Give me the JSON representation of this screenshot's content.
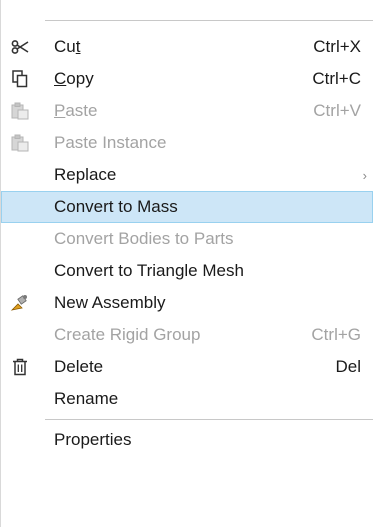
{
  "menu": {
    "cut": {
      "label": "Cut",
      "shortcut": "Ctrl+X",
      "icon": "scissors-icon"
    },
    "copy": {
      "label": "Copy",
      "shortcut": "Ctrl+C",
      "icon": "copy-icon"
    },
    "paste": {
      "label": "Paste",
      "shortcut": "Ctrl+V",
      "icon": "clipboard-icon"
    },
    "paste_instance": {
      "label": "Paste Instance",
      "icon": "clipboard-icon"
    },
    "replace": {
      "label": "Replace",
      "submenu_arrow": "›"
    },
    "convert_to_mass": {
      "label": "Convert to Mass"
    },
    "convert_bodies_to_parts": {
      "label": "Convert Bodies to Parts"
    },
    "convert_to_triangle_mesh": {
      "label": "Convert to Triangle Mesh"
    },
    "new_assembly": {
      "label": "New Assembly",
      "icon": "assembly-icon"
    },
    "create_rigid_group": {
      "label": "Create Rigid Group",
      "shortcut": "Ctrl+G"
    },
    "delete": {
      "label": "Delete",
      "shortcut": "Del",
      "icon": "trash-icon"
    },
    "rename": {
      "label": "Rename"
    },
    "properties": {
      "label": "Properties"
    }
  },
  "colors": {
    "highlight_bg": "#cde6f7",
    "highlight_border": "#99d1ef",
    "disabled_text": "#a3a3a3",
    "text": "#1a1a1a"
  }
}
